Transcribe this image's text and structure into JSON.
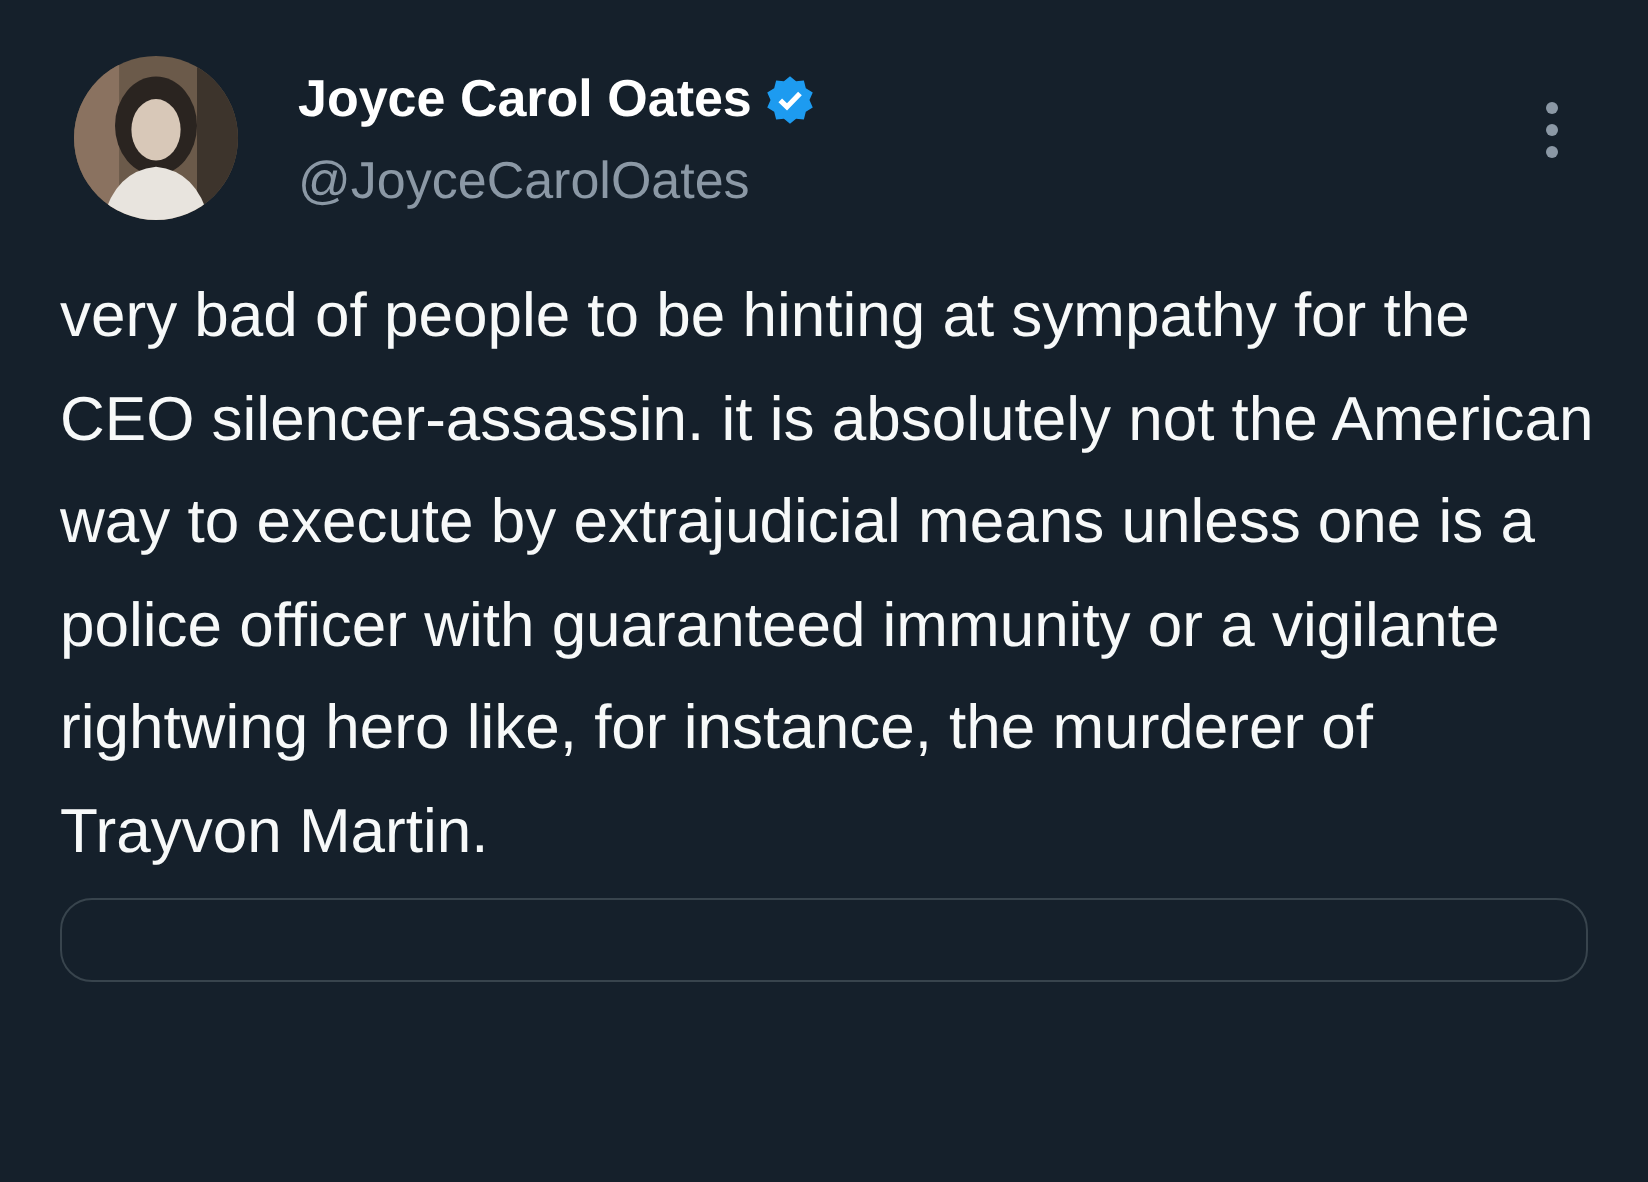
{
  "author": {
    "name": "Joyce Carol Oates",
    "handle": "@JoyceCarolOates",
    "verified": true
  },
  "text": "very bad of people to be hinting at sympathy for the CEO silencer-assassin. it is absolutely not the American way to execute by extrajudicial means unless one is a police officer with guaranteed immunity or a vigilante rightwing hero like, for instance, the murderer of Trayvon Martin."
}
